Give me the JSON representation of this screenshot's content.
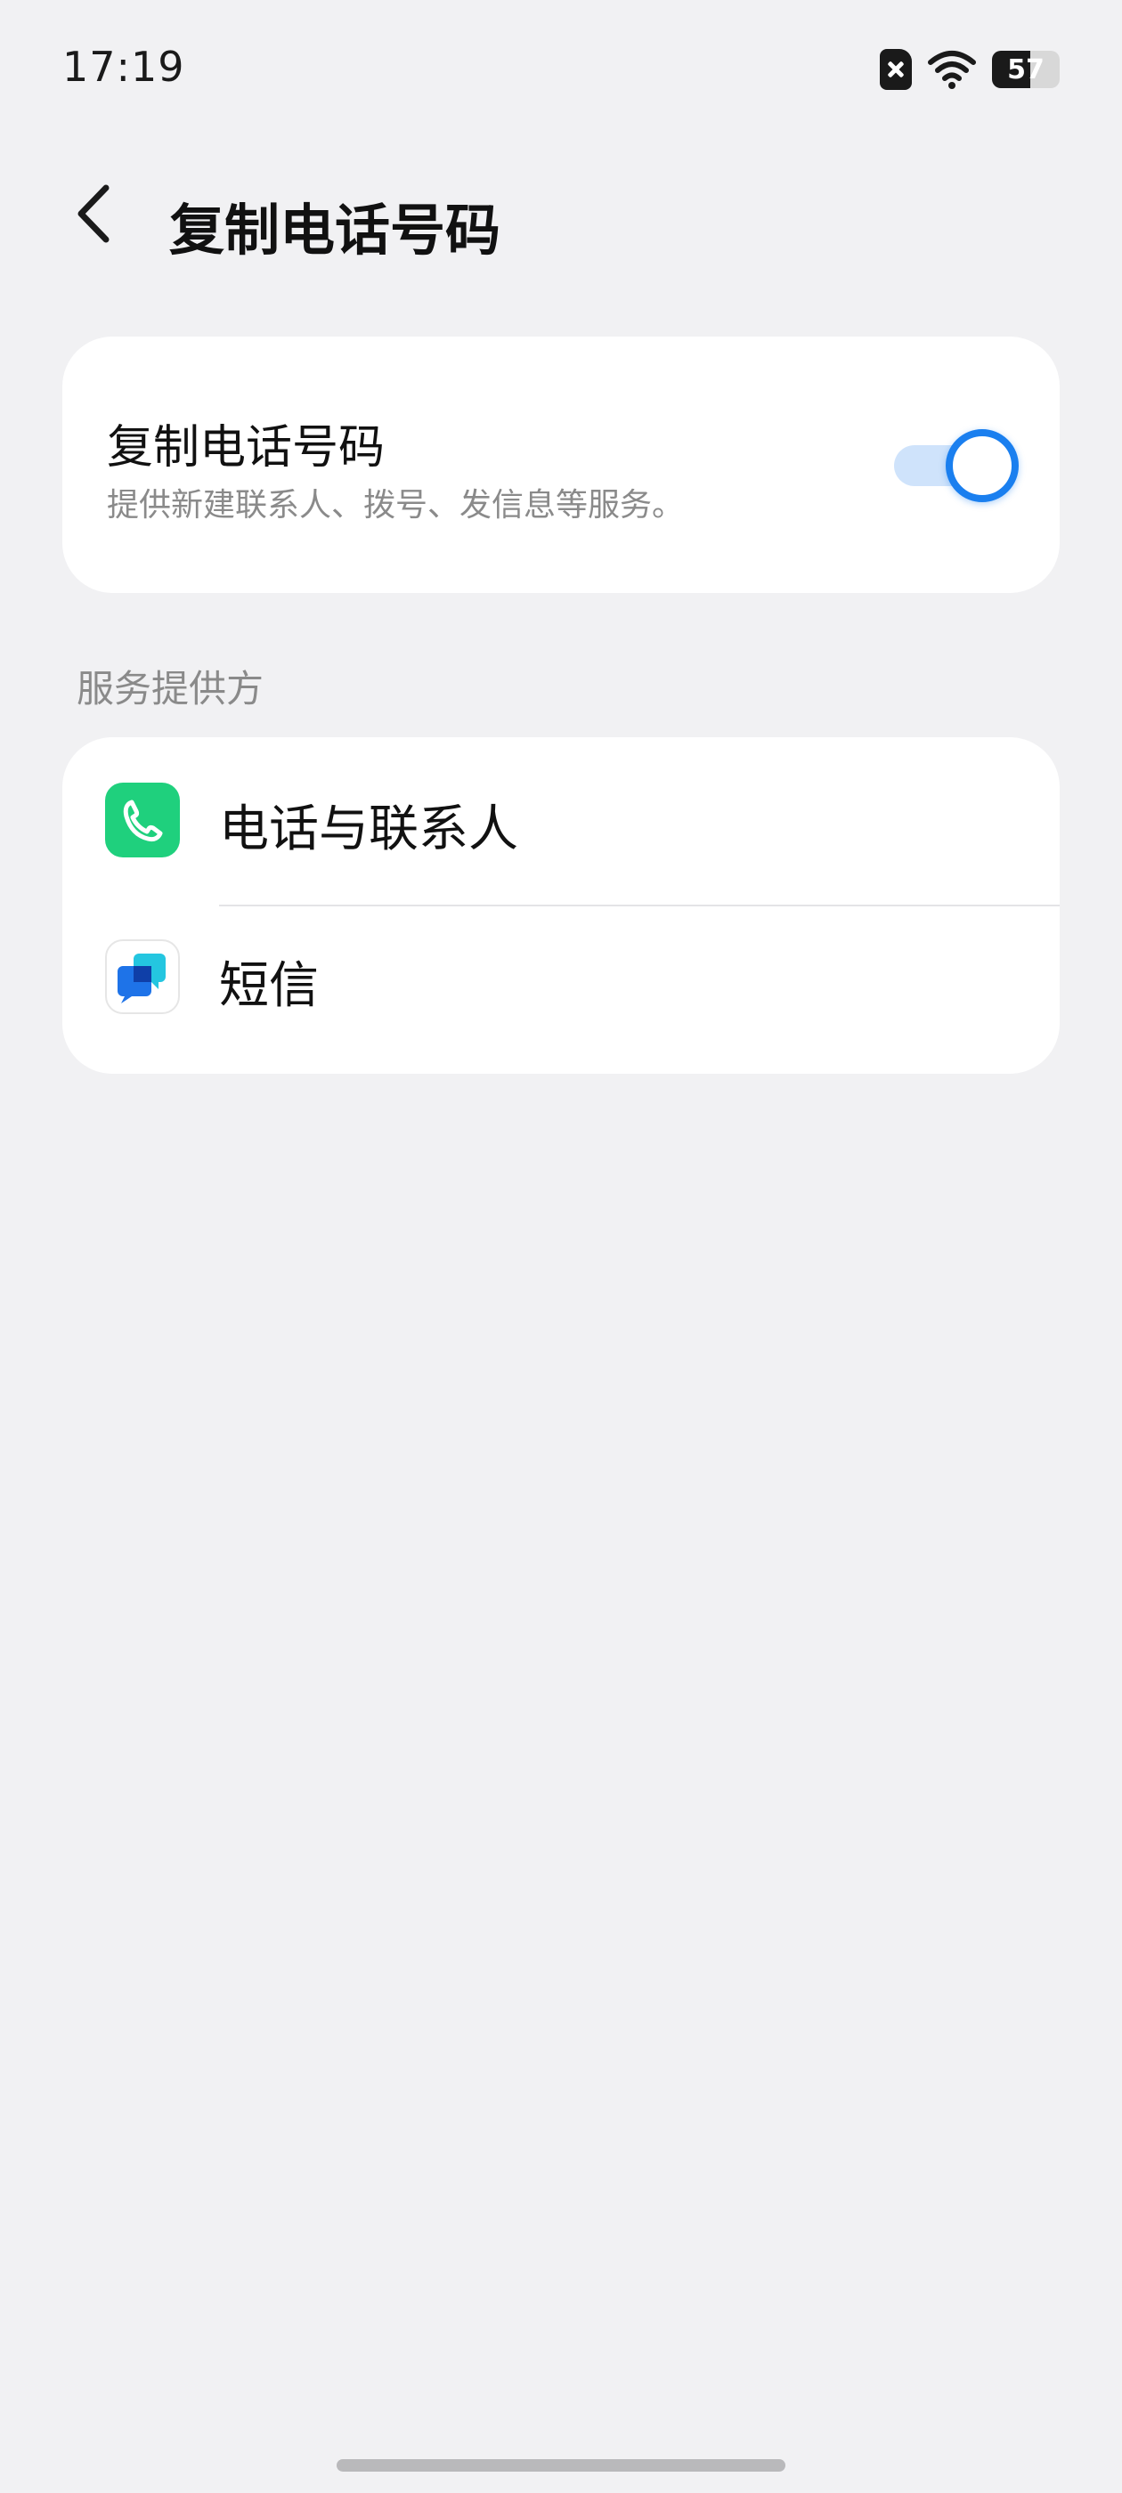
{
  "status_bar": {
    "time": "17:19",
    "battery_level": "57",
    "icons": [
      "no-sim-icon",
      "wifi-icon",
      "battery-icon"
    ]
  },
  "header": {
    "back_icon": "chevron-left-icon",
    "title": "复制电话号码"
  },
  "toggle_card": {
    "title": "复制电话号码",
    "subtitle": "提供新建联系人、拨号、发信息等服务。",
    "enabled": true,
    "accent_color": "#1a7fef"
  },
  "providers": {
    "section_label": "服务提供方",
    "items": [
      {
        "label": "电话与联系人",
        "icon": "phone-app-icon",
        "color": "#1fd07d"
      },
      {
        "label": "短信",
        "icon": "messages-app-icon",
        "color": "#1e88e5"
      }
    ]
  }
}
